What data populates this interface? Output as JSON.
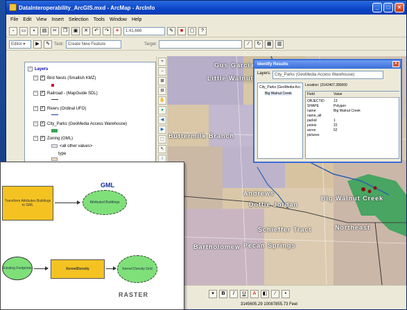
{
  "window": {
    "title": "DataInteroperability_ArcGIS.mxd - ArcMap - ArcInfo"
  },
  "menu": [
    "File",
    "Edit",
    "View",
    "Insert",
    "Selection",
    "Tools",
    "Window",
    "Help"
  ],
  "toolbar": {
    "scale": "1:41,666",
    "editor_label": "Editor ▾",
    "task_label": "Task:",
    "task_value": "Create New Feature",
    "target_label": "Target:"
  },
  "toc": {
    "root": "Layers",
    "layers": [
      {
        "name": "Bird Nests (Smallish KMZ)",
        "checked": true
      },
      {
        "name": "Railroad - (MapGuide SDL)",
        "checked": true
      },
      {
        "name": "Rivers (Ordinal UFO)",
        "checked": true
      },
      {
        "name": "City_Parks (GeoMedia Access Warehouse)",
        "checked": true
      },
      {
        "name": "Zoning (GML)",
        "checked": true
      }
    ],
    "sublabels": [
      "<all other values>",
      "type"
    ]
  },
  "map_labels": [
    "Gus Garcia",
    "Little Walnut",
    "Buttermilk Branch",
    "Andrews",
    "Dottie Jordan",
    "Big Walnut Creek",
    "Schieffer Tract",
    "Northeast",
    "Bartholomew",
    "Pecan Springs"
  ],
  "identify": {
    "title": "Identify Results",
    "layers_label": "Layers:",
    "layers_value": "City_Parks (GeoMedia Access Warehouse)",
    "tree_root": "City_Parks (GeoMedia Acc",
    "tree_child": "Big Walnut Creek",
    "location": "Location: (3142407.280000",
    "col_field": "Field",
    "col_value": "Value",
    "rows": [
      {
        "f": "OBJECTID",
        "v": "13"
      },
      {
        "f": "SHAPE",
        "v": "Polygon"
      },
      {
        "f": "name",
        "v": "Big Walnut Creek"
      },
      {
        "f": "name_alt",
        "v": ""
      },
      {
        "f": "parkid",
        "v": "1"
      },
      {
        "f": "points",
        "v": "22"
      },
      {
        "f": "acres",
        "v": "52"
      },
      {
        "f": "pictures",
        "v": ""
      }
    ]
  },
  "status": {
    "coords": "3145605.29  10087855.73 Feet"
  },
  "diagram": {
    "gml_label": "GML",
    "raster_label": "RASTER",
    "box1": "Transform Attributes Buildings to GML",
    "oval1": "Attributed Buildings",
    "oval2": "Existing Footprints",
    "box2": "KernelDensity",
    "oval3": "Kernel Density Grid"
  },
  "colors": {
    "title_blue": "#0b44c8",
    "park_green": "#3aa35a",
    "parcel_tan": "#d9c7a8",
    "box_yellow": "#f4c322",
    "oval_green": "#7fe07a"
  }
}
